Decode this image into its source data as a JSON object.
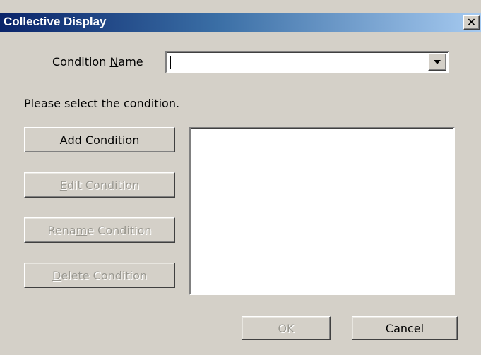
{
  "window": {
    "title": "Collective Display",
    "close_glyph": "✕"
  },
  "condition_name": {
    "label_prefix": "Condition ",
    "label_accel": "N",
    "label_suffix": "ame",
    "value": ""
  },
  "instruction": "Please select the condition.",
  "buttons": {
    "add": {
      "prefix": "",
      "accel": "A",
      "suffix": "dd Condition",
      "enabled": true
    },
    "edit": {
      "prefix": "",
      "accel": "E",
      "suffix": "dit Condition",
      "enabled": false
    },
    "rename": {
      "prefix": "Rena",
      "accel": "m",
      "suffix": "e Condition",
      "enabled": false
    },
    "delete": {
      "prefix": "",
      "accel": "D",
      "suffix": "elete Condition",
      "enabled": false
    },
    "ok": {
      "label": "OK",
      "enabled": false
    },
    "cancel": {
      "label": "Cancel",
      "enabled": true
    }
  },
  "condition_list": []
}
